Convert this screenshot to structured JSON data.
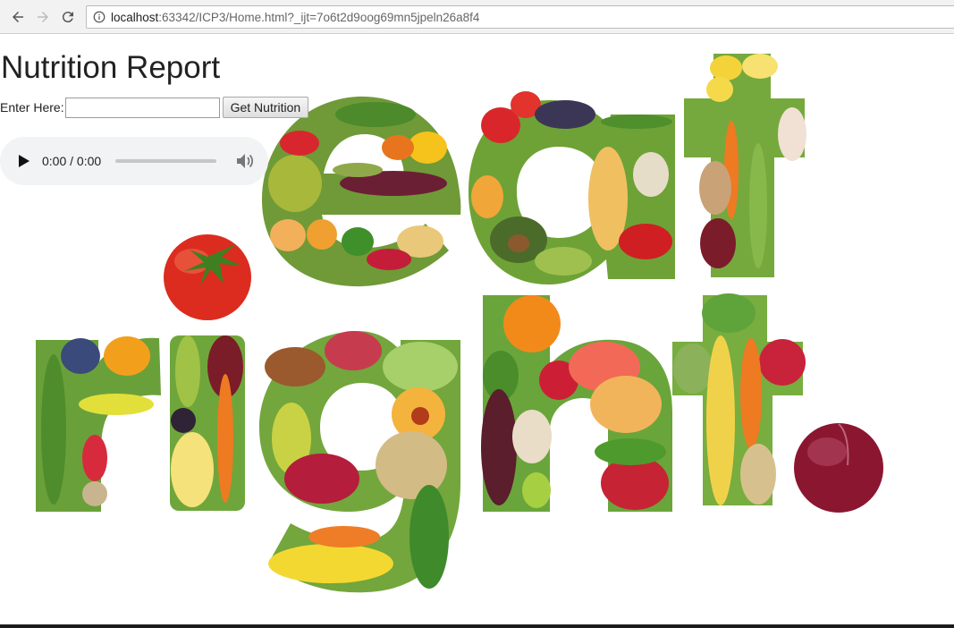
{
  "browser": {
    "url_host": "localhost",
    "url_rest": ":63342/ICP3/Home.html?_ijt=7o6t2d9oog69mn5jpeln26a8f4",
    "back_icon": "arrow-left-icon",
    "forward_icon": "arrow-right-icon",
    "reload_icon": "reload-icon",
    "info_icon": "info-icon"
  },
  "page": {
    "title": "Nutrition Report",
    "input_label": "Enter Here:",
    "input_value": "",
    "button_label": "Get Nutrition"
  },
  "audio": {
    "time": "0:00 / 0:00",
    "play_icon": "play-icon",
    "volume_icon": "volume-icon"
  },
  "image": {
    "alt_letters": "eat right.",
    "description_colors": {
      "tomato": "#d9261c",
      "onion": "#8c1530",
      "leaf": "#4c9a2a",
      "banana": "#f2d22e",
      "carrot": "#f07c1e"
    }
  }
}
